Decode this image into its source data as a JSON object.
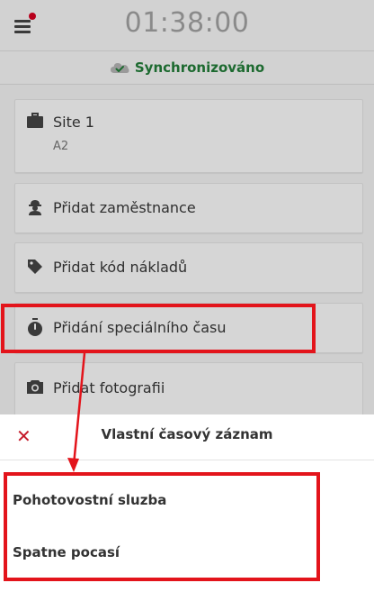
{
  "header": {
    "time": "01:38:00",
    "sync_status": "Synchronizováno"
  },
  "site": {
    "name": "Site 1",
    "subtitle": "A2"
  },
  "menu_items": [
    {
      "label": "Přidat zaměstnance",
      "icon": "worker-icon"
    },
    {
      "label": "Přidat kód nákladů",
      "icon": "tag-icon"
    },
    {
      "label": "Přidání speciálního času",
      "icon": "stopwatch-icon"
    },
    {
      "label": "Přidat fotografii",
      "icon": "camera-icon"
    }
  ],
  "sheet": {
    "title": "Vlastní časový záznam",
    "options": [
      "Pohotovostní sluzba",
      "Spatne pocasí"
    ]
  },
  "colors": {
    "highlight": "#e3141b",
    "sync_green": "#1d6a30",
    "close_red": "#c51a2a"
  }
}
